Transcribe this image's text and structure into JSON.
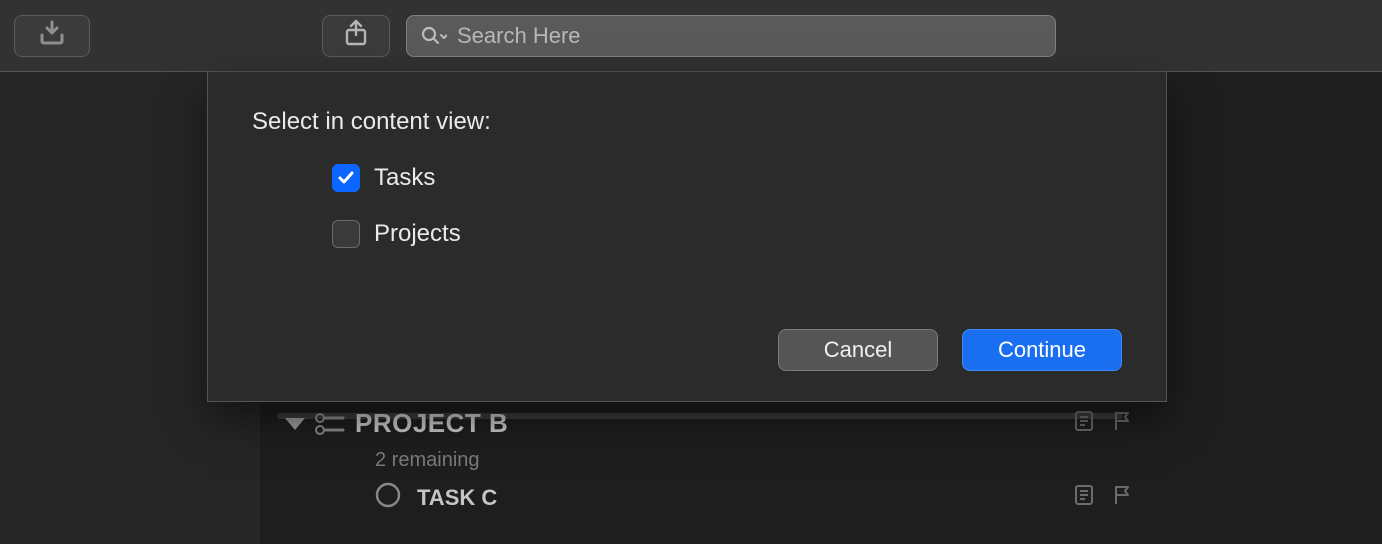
{
  "toolbar": {
    "search_placeholder": "Search Here"
  },
  "dialog": {
    "title": "Select in content view:",
    "options": [
      {
        "label": "Tasks",
        "checked": true
      },
      {
        "label": "Projects",
        "checked": false
      }
    ],
    "cancel_label": "Cancel",
    "continue_label": "Continue"
  },
  "content": {
    "project": {
      "title": "PROJECT B",
      "subtitle": "2 remaining",
      "tasks": [
        {
          "title": "TASK C"
        }
      ]
    }
  }
}
